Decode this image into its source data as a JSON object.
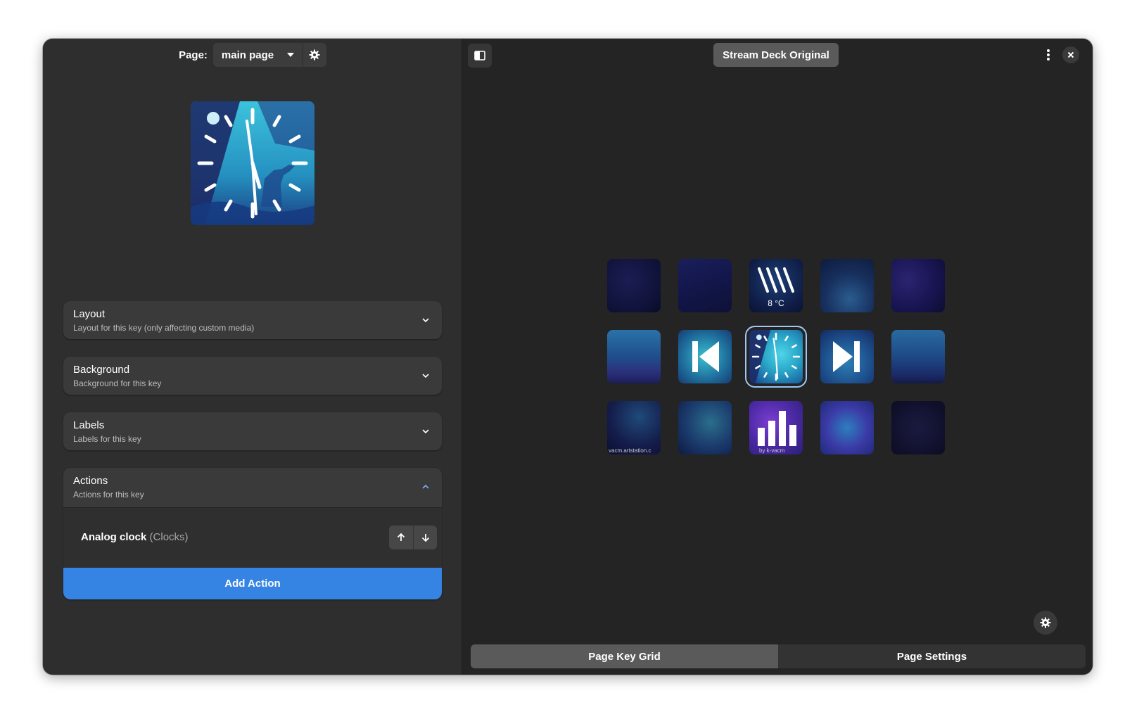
{
  "sidebar": {
    "page_label": "Page:",
    "page_value": "main page",
    "sections": {
      "layout": {
        "title": "Layout",
        "subtitle": "Layout for this key (only affecting custom media)"
      },
      "background": {
        "title": "Background",
        "subtitle": "Background for this key"
      },
      "labels": {
        "title": "Labels",
        "subtitle": "Labels for this key"
      },
      "actions": {
        "title": "Actions",
        "subtitle": "Actions for this key"
      }
    },
    "action": {
      "name": "Analog clock",
      "category": "(Clocks)"
    },
    "add_action_label": "Add Action"
  },
  "header": {
    "deck_title": "Stream Deck Original"
  },
  "keys": {
    "weather_label": "8 °C",
    "footer_1": "vacm.artstation.c",
    "footer_2": "by k-vacm"
  },
  "tabs": {
    "key_grid": "Page Key Grid",
    "page_settings": "Page Settings"
  },
  "colors": {
    "accent": "#3584e4",
    "window_bg": "#242424",
    "sidebar_bg": "#2e2e2e"
  }
}
